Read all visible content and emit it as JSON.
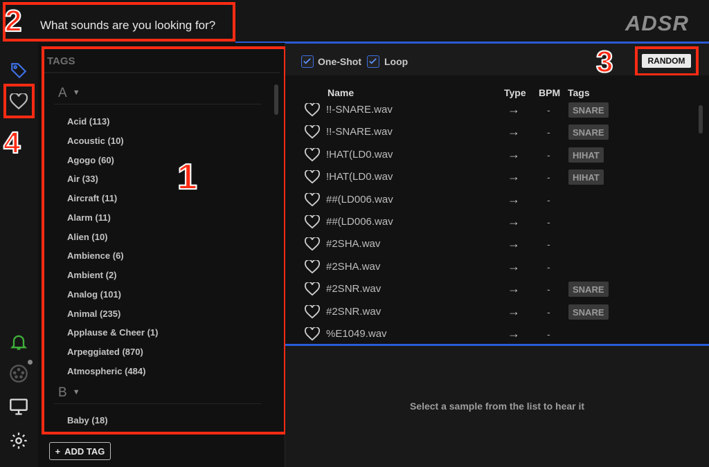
{
  "search": {
    "placeholder": "What sounds are you looking for?"
  },
  "logo": "ADSR",
  "annotations": [
    "1",
    "2",
    "3",
    "4"
  ],
  "rail": {
    "icons": [
      "tag-icon",
      "heart-icon",
      "bell-icon",
      "midi-icon",
      "monitor-icon",
      "gear-icon"
    ]
  },
  "tags_panel": {
    "title": "TAGS",
    "sections": [
      {
        "letter": "A",
        "items": [
          "Acid (113)",
          "Acoustic (10)",
          "Agogo (60)",
          "Air (33)",
          "Aircraft (11)",
          "Alarm (11)",
          "Alien (10)",
          "Ambience (6)",
          "Ambient (2)",
          "Analog (101)",
          "Animal (235)",
          "Applause & Cheer (1)",
          "Arpeggiated (870)",
          "Atmospheric (484)"
        ]
      },
      {
        "letter": "B",
        "items": [
          "Baby (18)"
        ]
      }
    ],
    "add_tag_label": "ADD TAG"
  },
  "filters": {
    "one_shot": "One-Shot",
    "loop": "Loop",
    "random": "RANDOM"
  },
  "columns": {
    "name": "Name",
    "type": "Type",
    "bpm": "BPM",
    "tags": "Tags"
  },
  "rows": [
    {
      "name": "!!-SNARE.wav",
      "type": "→",
      "bpm": "-",
      "tag": "SNARE"
    },
    {
      "name": "!!-SNARE.wav",
      "type": "→",
      "bpm": "-",
      "tag": "SNARE"
    },
    {
      "name": "!HAT(LD0.wav",
      "type": "→",
      "bpm": "-",
      "tag": "HIHAT"
    },
    {
      "name": "!HAT(LD0.wav",
      "type": "→",
      "bpm": "-",
      "tag": "HIHAT"
    },
    {
      "name": "##(LD006.wav",
      "type": "→",
      "bpm": "-",
      "tag": ""
    },
    {
      "name": "##(LD006.wav",
      "type": "→",
      "bpm": "-",
      "tag": ""
    },
    {
      "name": "#2SHA.wav",
      "type": "→",
      "bpm": "-",
      "tag": ""
    },
    {
      "name": "#2SHA.wav",
      "type": "→",
      "bpm": "-",
      "tag": ""
    },
    {
      "name": "#2SNR.wav",
      "type": "→",
      "bpm": "-",
      "tag": "SNARE"
    },
    {
      "name": "#2SNR.wav",
      "type": "→",
      "bpm": "-",
      "tag": "SNARE"
    },
    {
      "name": "%E1049.wav",
      "type": "→",
      "bpm": "-",
      "tag": ""
    }
  ],
  "player": {
    "message": "Select a sample from the list to hear it"
  },
  "colors": {
    "accent_blue": "#2a5bd7",
    "highlight_red": "#ff2b14",
    "bell_green": "#3fae3a"
  }
}
